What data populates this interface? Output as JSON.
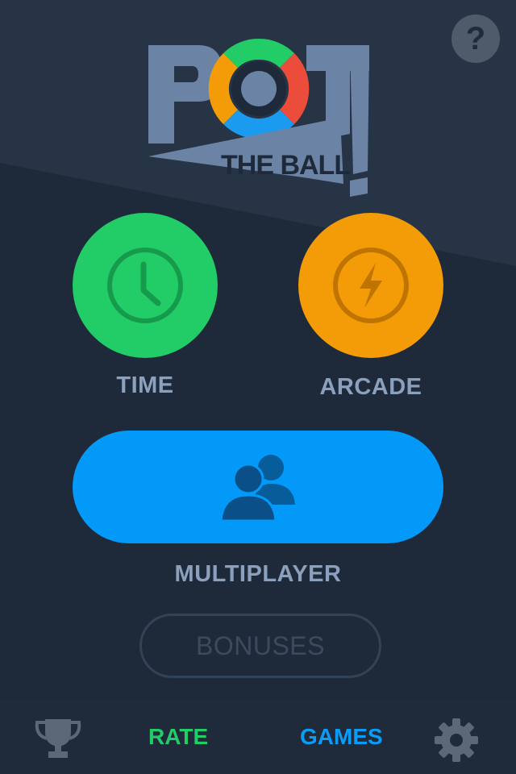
{
  "header": {
    "help_label": "?",
    "logo": {
      "line1": "POT",
      "line2": "THE BALL",
      "exclaim": "!"
    }
  },
  "modes": {
    "time": {
      "label": "TIME",
      "icon": "clock-icon",
      "color": "#22cc66"
    },
    "arcade": {
      "label": "ARCADE",
      "icon": "lightning-icon",
      "color": "#f39c07"
    },
    "multiplayer": {
      "label": "MULTIPLAYER",
      "icon": "users-icon",
      "color": "#0299f9"
    }
  },
  "bonuses": {
    "label": "BONUSES"
  },
  "bottom_nav": {
    "trophy_icon": "trophy-icon",
    "rate_label": "RATE",
    "games_label": "GAMES",
    "settings_icon": "gear-icon"
  },
  "colors": {
    "background": "#1e2a3a",
    "background_top": "#263446",
    "label": "#8aa0bc",
    "rate": "#22cc66",
    "games": "#0a9cf6"
  }
}
